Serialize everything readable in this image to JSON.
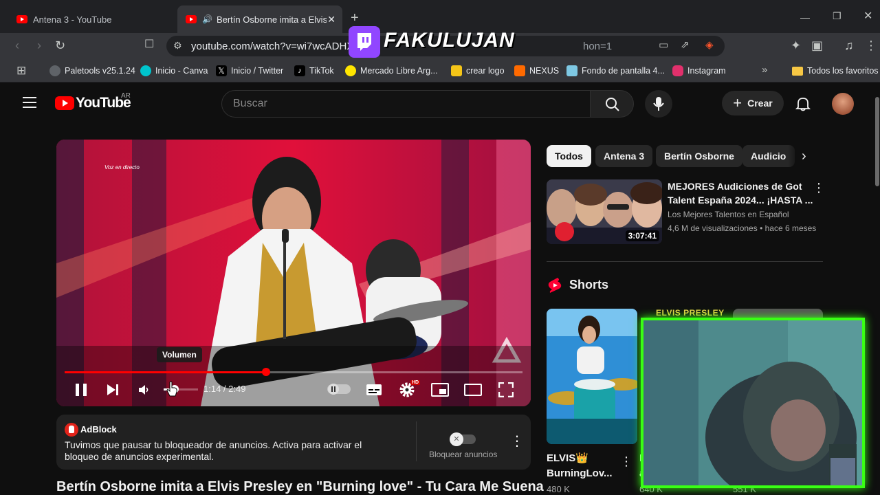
{
  "browser": {
    "tabs": [
      {
        "title": "Antena 3 - YouTube",
        "active": false
      },
      {
        "title": "Bertín Osborne imita a Elvis Presley en \"Burning love\"",
        "active": true
      }
    ],
    "url": "youtube.com/watch?v=wi7wcADHXs0",
    "url_tail": "hon=1",
    "bookmarks": [
      {
        "label": "Paletools v25.1.24",
        "icon": "paletools-icon",
        "color": "#5f6368"
      },
      {
        "label": "Inicio - Canva",
        "icon": "canva-icon",
        "color": "#00c4cc"
      },
      {
        "label": "Inicio / Twitter",
        "icon": "x-icon",
        "color": "#000000"
      },
      {
        "label": "TikTok",
        "icon": "tiktok-icon",
        "color": "#000000"
      },
      {
        "label": "Mercado Libre Arg...",
        "icon": "mercadolibre-icon",
        "color": "#ffe600"
      },
      {
        "label": "crear logo",
        "icon": "logo-icon",
        "color": "#f5c518"
      },
      {
        "label": "NEXUS",
        "icon": "nexus-icon",
        "color": "#ff6a00"
      },
      {
        "label": "Fondo de pantalla 4...",
        "icon": "wallpaper-icon",
        "color": "#7ec8e3"
      },
      {
        "label": "Instagram",
        "icon": "instagram-icon",
        "color": "#e1306c"
      }
    ],
    "all_bookmarks": "Todos los favoritos"
  },
  "overlay": {
    "streamer": "FAKULUJAN",
    "cam_label": "ELVIS PRESLEY"
  },
  "youtube": {
    "logo": "YouTube",
    "country": "AR",
    "search_placeholder": "Buscar",
    "create_label": "Crear"
  },
  "player": {
    "live_text": "Voz en directo",
    "time": "1:14 / 2:49",
    "progress": 0.44,
    "tooltip": "Volumen",
    "hd_badge": "HD"
  },
  "adblock": {
    "brand": "AdBlock",
    "message": "Tuvimos que pausar tu bloqueador de anuncios. Activa para activar el bloqueo de anuncios experimental.",
    "toggle_label": "Bloquear anuncios"
  },
  "video_title": "Bertín Osborne imita a Elvis Presley en \"Burning love\" - Tu Cara Me Suena",
  "chips": [
    "Todos",
    "Antena 3",
    "Bertín Osborne",
    "Audicio"
  ],
  "recommended": {
    "title_line1": "MEJORES Audiciones de Got",
    "title_line2": "Talent España 2024... ¡HASTA ...",
    "channel": "Los Mejores Talentos en Español",
    "stats": "4,6 M de visualizaciones • hace 6 meses",
    "duration": "3:07:41"
  },
  "shorts": {
    "heading": "Shorts",
    "items": [
      {
        "title_line1": "ELVIS👑",
        "title_line2": "BurningLov...",
        "views": "480 K"
      },
      {
        "title_line1": "L",
        "title_line2": "a",
        "views": "640 K"
      },
      {
        "title_line1": "",
        "title_line2": "",
        "views": "551 K"
      }
    ]
  }
}
